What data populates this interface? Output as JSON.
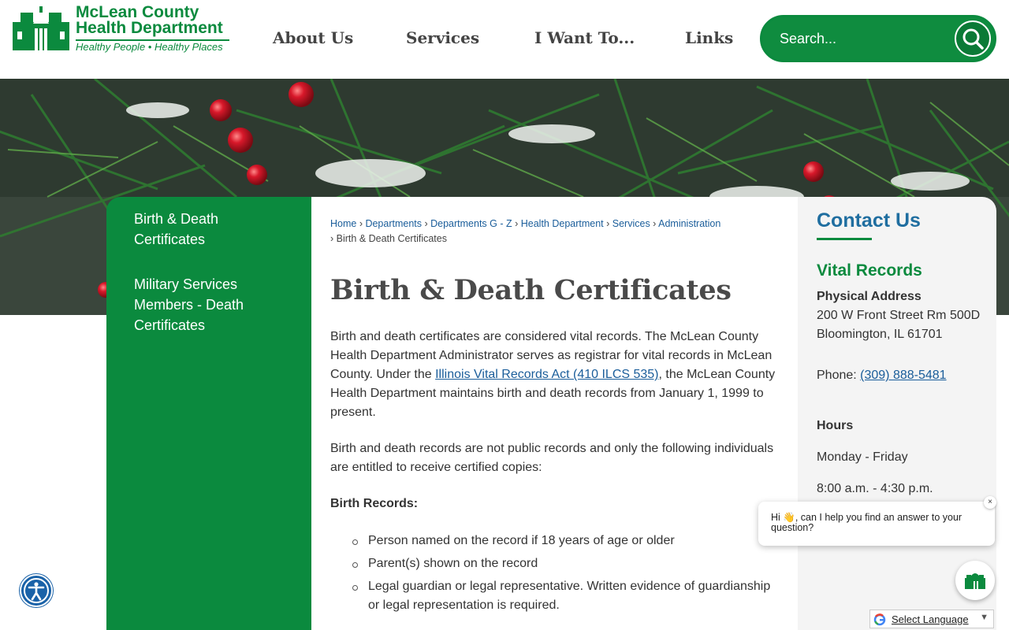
{
  "logo": {
    "line1": "McLean County",
    "line2": "Health Department",
    "tagline": "Healthy People • Healthy Places"
  },
  "nav": {
    "about": "About Us",
    "services": "Services",
    "iwant": "I Want To...",
    "links": "Links"
  },
  "search": {
    "placeholder": "Search..."
  },
  "sidebar": {
    "items": [
      {
        "label": "Birth & Death Certificates"
      },
      {
        "label": "Military Services Members - Death Certificates"
      }
    ]
  },
  "breadcrumb": {
    "home": "Home",
    "departments": "Departments",
    "dept_gz": "Departments G - Z",
    "health": "Health Department",
    "services": "Services",
    "admin": "Administration",
    "current": "Birth & Death Certificates"
  },
  "main": {
    "title": "Birth & Death Certificates",
    "p1_a": "Birth and death certificates are considered vital records. The McLean County Health Department Administrator serves as registrar for vital records in McLean County. Under the ",
    "p1_link": "Illinois Vital Records Act (410 ILCS 535)",
    "p1_b": ", the McLean County Health Department maintains birth and death records from January 1, 1999 to present.",
    "p2": "Birth and death records are not public records and only the following individuals are entitled to receive certified copies:",
    "birth_heading": "Birth Records:",
    "birth_list": [
      "Person named on the record if 18 years of age or older",
      "Parent(s) shown on the record",
      "Legal guardian or legal representative. Written evidence of guardianship or legal representation is required."
    ]
  },
  "contact": {
    "title": "Contact Us",
    "subtitle": "Vital Records",
    "addr_label": "Physical Address",
    "addr1": "200 W Front Street Rm 500D",
    "addr2": "Bloomington, IL 61701",
    "phone_label": "Phone: ",
    "phone": "(309) 888-5481",
    "hours_label": "Hours",
    "days": "Monday - Friday",
    "time": "8:00 a.m. - 4:30 p.m."
  },
  "chat": {
    "message": "Hi 👋, can I help you find an answer to your question?",
    "close": "×"
  },
  "translate": {
    "label": "Select Language",
    "arrow": "▼"
  },
  "colors": {
    "brand_green": "#0b8a3e",
    "link_blue": "#1a5d9a",
    "heading_blue": "#1f6ea0"
  }
}
